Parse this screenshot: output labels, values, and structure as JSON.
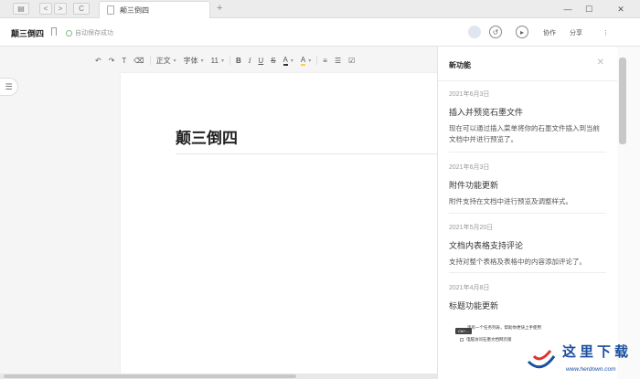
{
  "tabbar": {
    "tab_label": "颠三倒四",
    "new_tab": "+",
    "back": "<",
    "forward": ">",
    "refresh": "C",
    "minimize": "—",
    "maximize": "☐",
    "close": "✕"
  },
  "header": {
    "doc_title": "颠三倒四",
    "save_status": "自动保存成功",
    "collab_label": "协作",
    "share_label": "分享",
    "more_label": "⋮"
  },
  "toolbar": {
    "paragraph_style": "正文",
    "font_family": "字体",
    "font_size": "11",
    "bold": "B",
    "italic": "I",
    "underline": "U",
    "strike": "S",
    "font_color": "A",
    "highlight": "A"
  },
  "document": {
    "title": "颠三倒四"
  },
  "panel": {
    "title": "新功能",
    "close": "✕",
    "items": [
      {
        "date": "2021年6月3日",
        "title": "插入并预览石墨文件",
        "desc": "现在可以通过插入菜单将你的石墨文件插入到当前文档中并进行预览了。"
      },
      {
        "date": "2021年6月3日",
        "title": "附件功能更新",
        "desc": "附件支持在文档中进行预览及调整样式。"
      },
      {
        "date": "2021年5月20日",
        "title": "文档内表格支持评论",
        "desc": "支持对整个表格及表格中的内容添加评论了。"
      },
      {
        "date": "2021年4月8日",
        "title": "标题功能更新",
        "desc": ""
      }
    ],
    "mini_badge": "Ctrl+...",
    "mini_line1": "里有一个任务列表，帮助你更快上手使用",
    "mini_line2": "电脑访问石墨文档网页版"
  },
  "watermark": {
    "cn": "这里下载",
    "url": "www.herdown.com"
  },
  "colors": {
    "brand_blue": "#1a4fa0",
    "save_ok": "#7bbf7b"
  }
}
